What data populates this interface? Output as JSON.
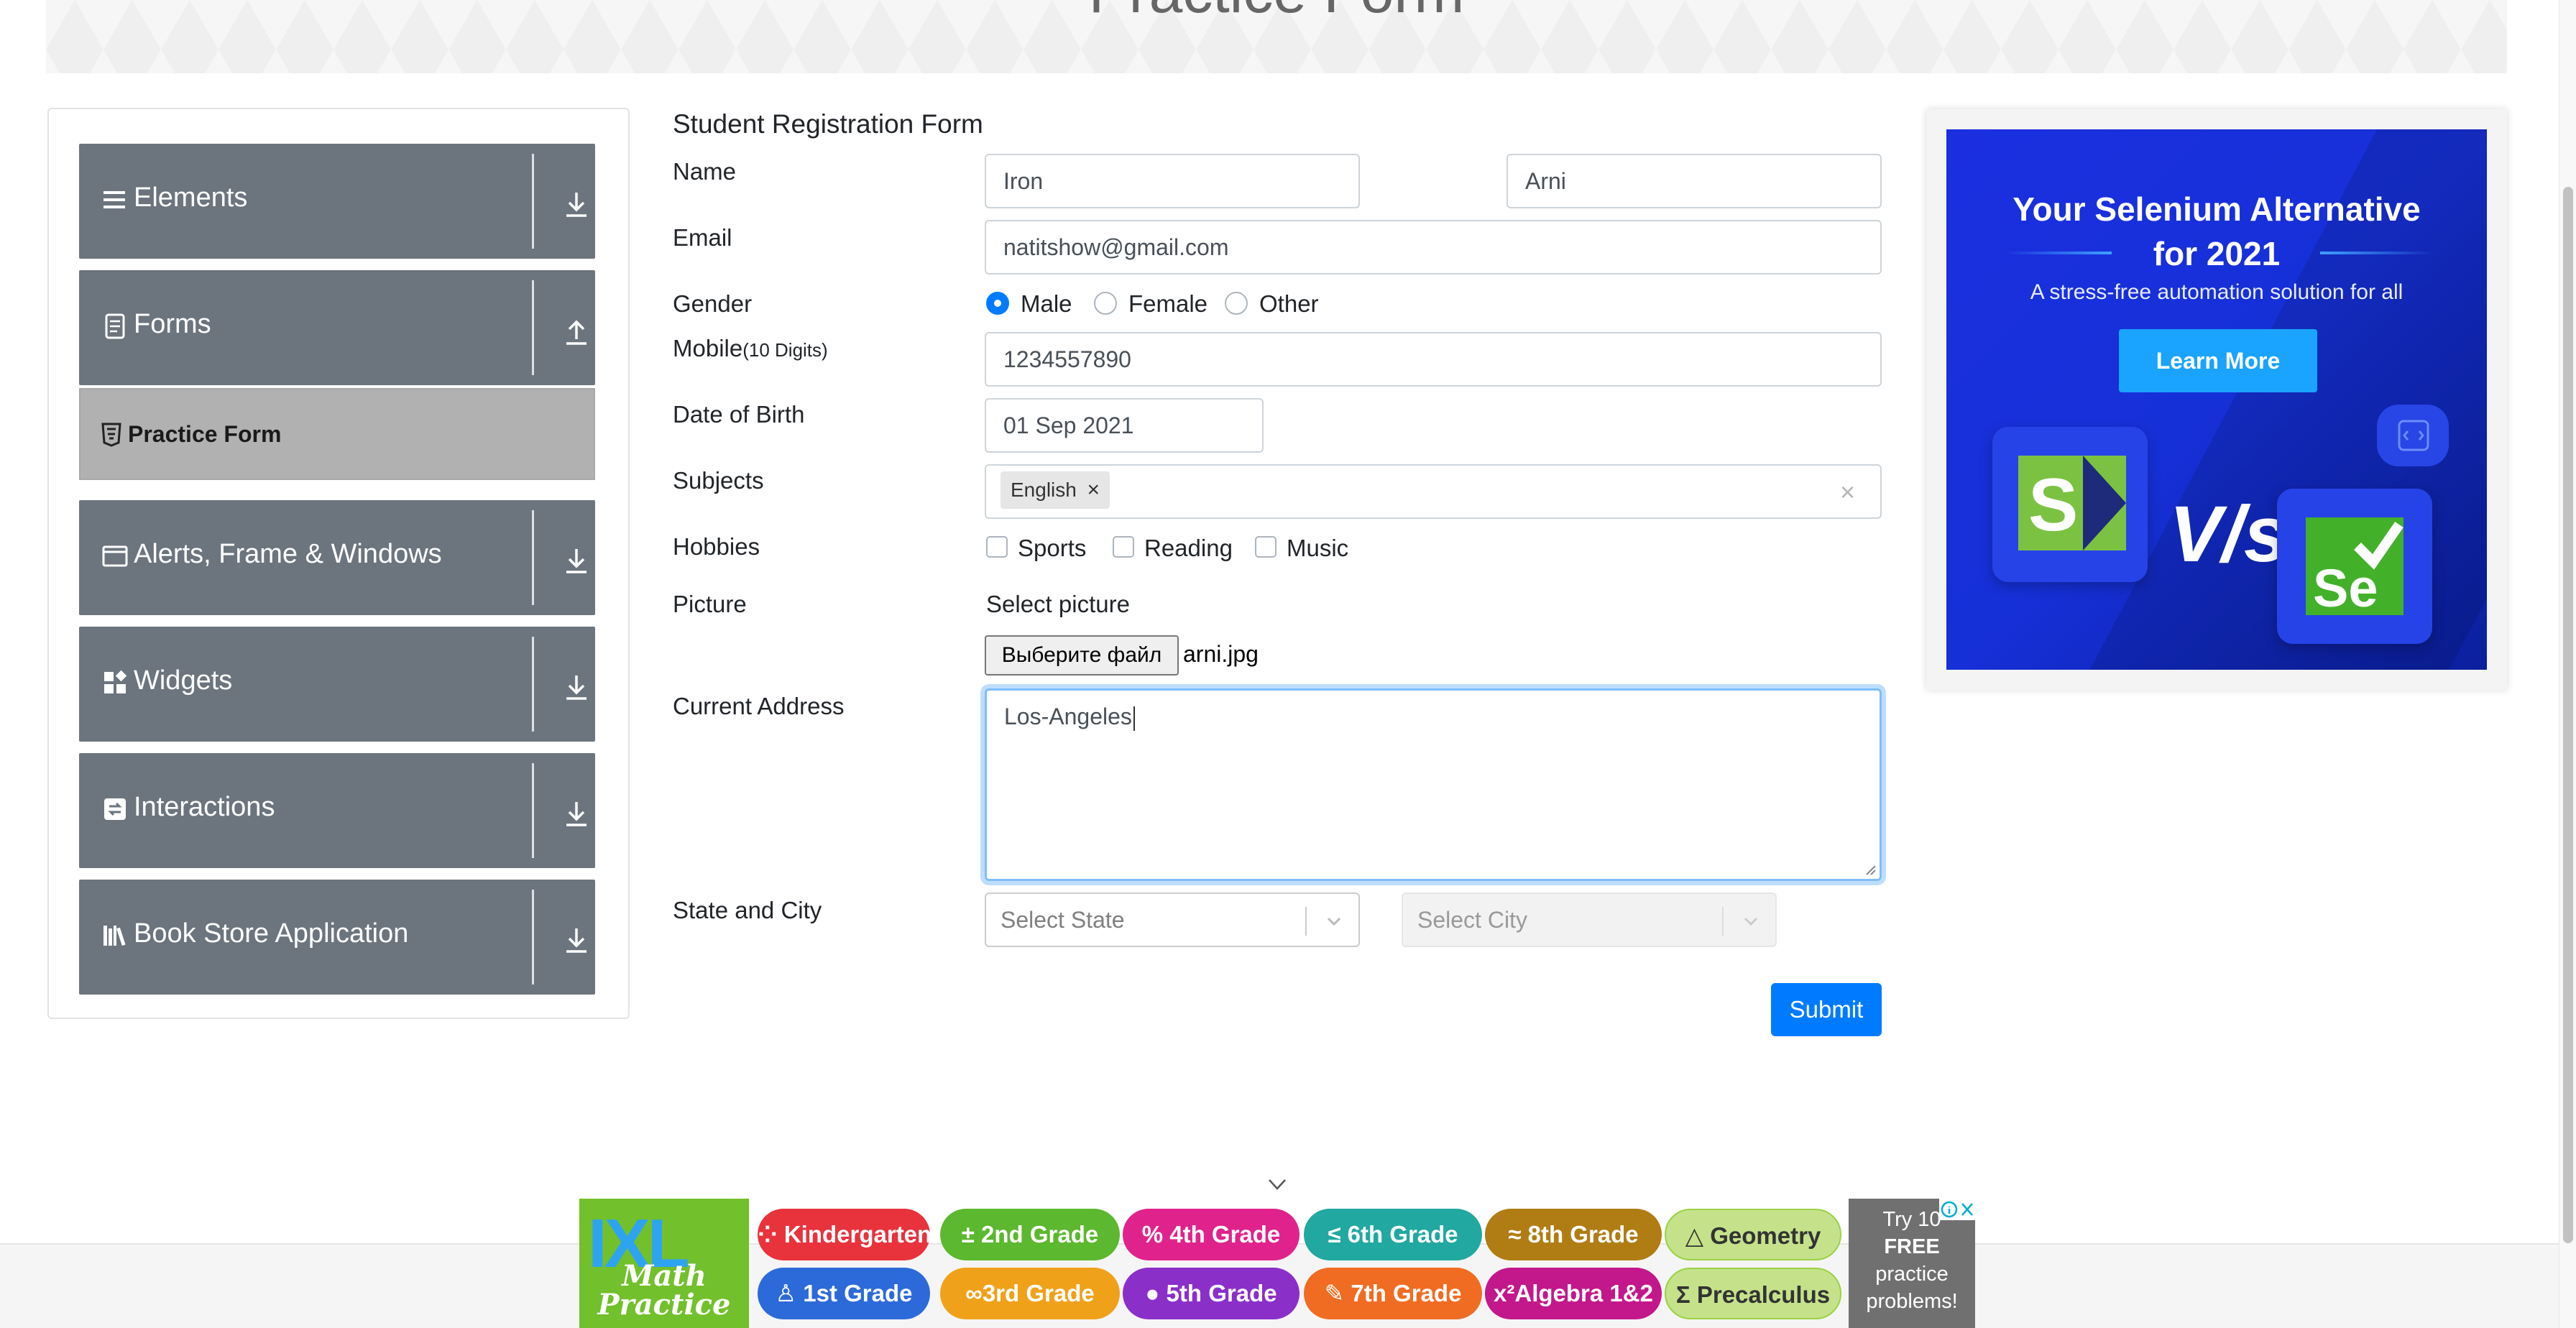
{
  "page": {
    "banner_title": "Practice Form"
  },
  "sidebar": {
    "groups": [
      {
        "label": "Elements",
        "icon": "hamburger-icon",
        "arrow": "download-arrow-icon"
      },
      {
        "label": "Forms",
        "icon": "document-icon",
        "arrow": "upload-arrow-icon"
      },
      {
        "label": "Alerts, Frame & Windows",
        "icon": "window-icon",
        "arrow": "download-arrow-icon"
      },
      {
        "label": "Widgets",
        "icon": "widgets-icon",
        "arrow": "download-arrow-icon"
      },
      {
        "label": "Interactions",
        "icon": "interactions-icon",
        "arrow": "download-arrow-icon"
      },
      {
        "label": "Book Store Application",
        "icon": "books-icon",
        "arrow": "download-arrow-icon"
      }
    ],
    "active_item": {
      "label": "Practice Form",
      "icon": "html5-icon"
    }
  },
  "form": {
    "title": "Student Registration Form",
    "labels": {
      "name": "Name",
      "email": "Email",
      "gender": "Gender",
      "mobile": "Mobile",
      "mobile_hint": "(10 Digits)",
      "dob": "Date of Birth",
      "subjects": "Subjects",
      "hobbies": "Hobbies",
      "picture": "Picture",
      "address": "Current Address",
      "state_city": "State and City"
    },
    "first_name": "Iron",
    "last_name": "Arni",
    "email": "natitshow@gmail.com",
    "gender_options": [
      {
        "label": "Male",
        "checked": true
      },
      {
        "label": "Female",
        "checked": false
      },
      {
        "label": "Other",
        "checked": false
      }
    ],
    "mobile": "1234557890",
    "dob": "01 Sep 2021",
    "subjects": [
      {
        "label": "English",
        "remove": "×"
      }
    ],
    "subjects_clear": "×",
    "hobbies": [
      {
        "label": "Sports",
        "checked": false
      },
      {
        "label": "Reading",
        "checked": false
      },
      {
        "label": "Music",
        "checked": false
      }
    ],
    "picture_caption": "Select picture",
    "file_button": "Выберите файл",
    "file_name": "arni.jpg",
    "address": "Los-Angeles",
    "state_placeholder": "Select State",
    "city_placeholder": "Select City",
    "submit": "Submit"
  },
  "ad": {
    "headline_line1": "Your Selenium Alternative",
    "headline_line2": "for 2021",
    "subline": "A stress-free automation solution for all",
    "button": "Learn More",
    "vs": "V/s",
    "left_logo_letter": "S",
    "right_logo_text": "Se",
    "colors": {
      "bg": "#1630d8",
      "button": "#1aa3ff",
      "left_logo": "#7cc242",
      "right_logo": "#43b02a"
    }
  },
  "bottom_ad": {
    "logo": "IXL",
    "logo_sub_1": "Math",
    "logo_sub_2": "Practice",
    "pills": [
      {
        "label": "Kindergarten",
        "icon": "dots-icon",
        "color": "#e8333d"
      },
      {
        "label": "2nd Grade",
        "icon": "plus-minus-icon",
        "color": "#5cb82e"
      },
      {
        "label": "4th Grade",
        "icon": "percent-icon",
        "color": "#e0238c"
      },
      {
        "label": "6th Grade",
        "icon": "less-equal-icon",
        "color": "#21a8a0"
      },
      {
        "label": "8th Grade",
        "icon": "approx-icon",
        "color": "#b07d14"
      },
      {
        "label": "Geometry",
        "icon": "triangle-icon",
        "color": "#c5e28a"
      },
      {
        "label": "1st Grade",
        "icon": "cup-icon",
        "color": "#2d6ad9"
      },
      {
        "label": "3rd Grade",
        "icon": "infinity-icon",
        "color": "#f0a11a"
      },
      {
        "label": "5th Grade",
        "icon": "apple-icon",
        "color": "#8b2fc9"
      },
      {
        "label": "7th Grade",
        "icon": "pencil-icon",
        "color": "#f06c22"
      },
      {
        "label": "Algebra 1&2",
        "icon": "x-squared-icon",
        "color": "#c2188b"
      },
      {
        "label": "Precalculus",
        "icon": "sigma-icon",
        "color": "#9bd145"
      }
    ],
    "try_line1": "Try 10",
    "try_line2": "FREE",
    "try_line3": "practice",
    "try_line4": "problems!"
  }
}
